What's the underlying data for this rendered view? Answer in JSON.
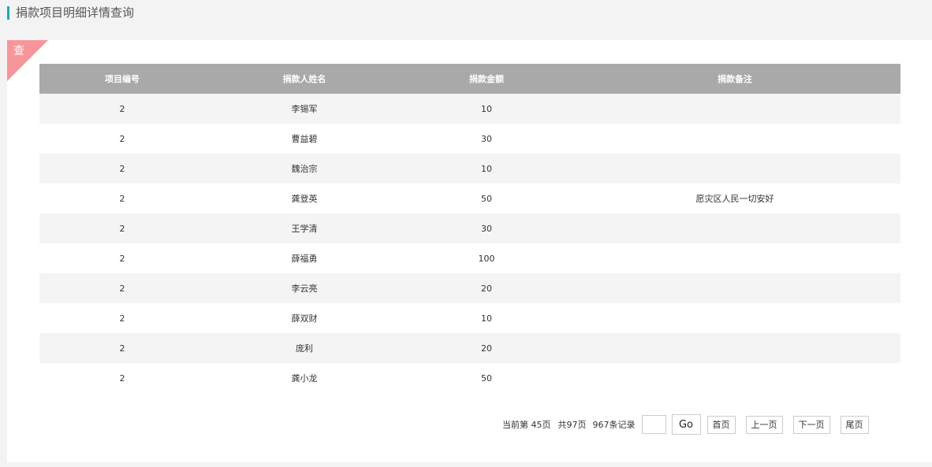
{
  "page": {
    "title": "捐款项目明细详情查询"
  },
  "panel": {
    "tag": "查"
  },
  "table": {
    "headers": [
      "项目编号",
      "捐款人姓名",
      "捐款金额",
      "捐款备注"
    ],
    "rows": [
      [
        "2",
        "李锡军",
        "10",
        ""
      ],
      [
        "2",
        "曹益碧",
        "30",
        ""
      ],
      [
        "2",
        "魏治宗",
        "10",
        ""
      ],
      [
        "2",
        "龚登英",
        "50",
        "愿灾区人民一切安好"
      ],
      [
        "2",
        "王学清",
        "30",
        ""
      ],
      [
        "2",
        "薛福勇",
        "100",
        ""
      ],
      [
        "2",
        "李云亮",
        "20",
        ""
      ],
      [
        "2",
        "薛双财",
        "10",
        ""
      ],
      [
        "2",
        "庞利",
        "20",
        ""
      ],
      [
        "2",
        "龚小龙",
        "50",
        ""
      ]
    ]
  },
  "pager": {
    "current": "当前第 45页",
    "total_pages": "共97页",
    "total_records": "967条记录",
    "jump_value": "",
    "go_label": "Go",
    "first_label": "首页",
    "prev_label": "上一页",
    "next_label": "下一页",
    "last_label": "尾页"
  }
}
